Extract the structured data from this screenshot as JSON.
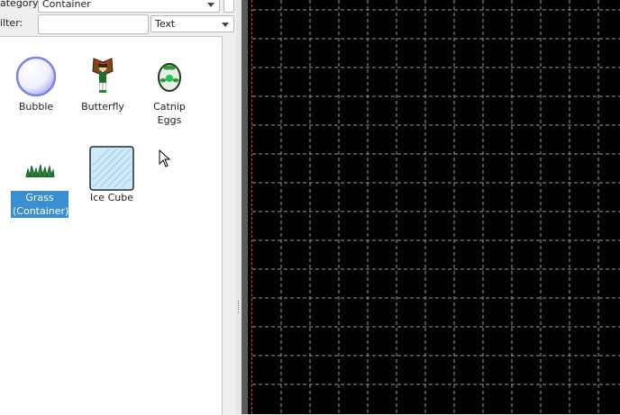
{
  "category": {
    "label": "ategory:",
    "value": "Container"
  },
  "filter": {
    "label": "ilter:",
    "value": "",
    "mode": "Text"
  },
  "palette": {
    "items": [
      {
        "name": "Bubble",
        "icon": "bubble-icon"
      },
      {
        "name": "Butterfly",
        "icon": "butterfly-icon"
      },
      {
        "name": "Catnip\nEggs",
        "icon": "catnip-eggs-icon"
      },
      {
        "name": "Grass\n(Container)",
        "icon": "grass-icon",
        "selected": true
      },
      {
        "name": "Ice Cube",
        "icon": "ice-cube-icon"
      }
    ]
  },
  "canvas": {
    "background": "#000000",
    "grid_color": "#9a9a9a",
    "bound_color": "#ff3030"
  }
}
